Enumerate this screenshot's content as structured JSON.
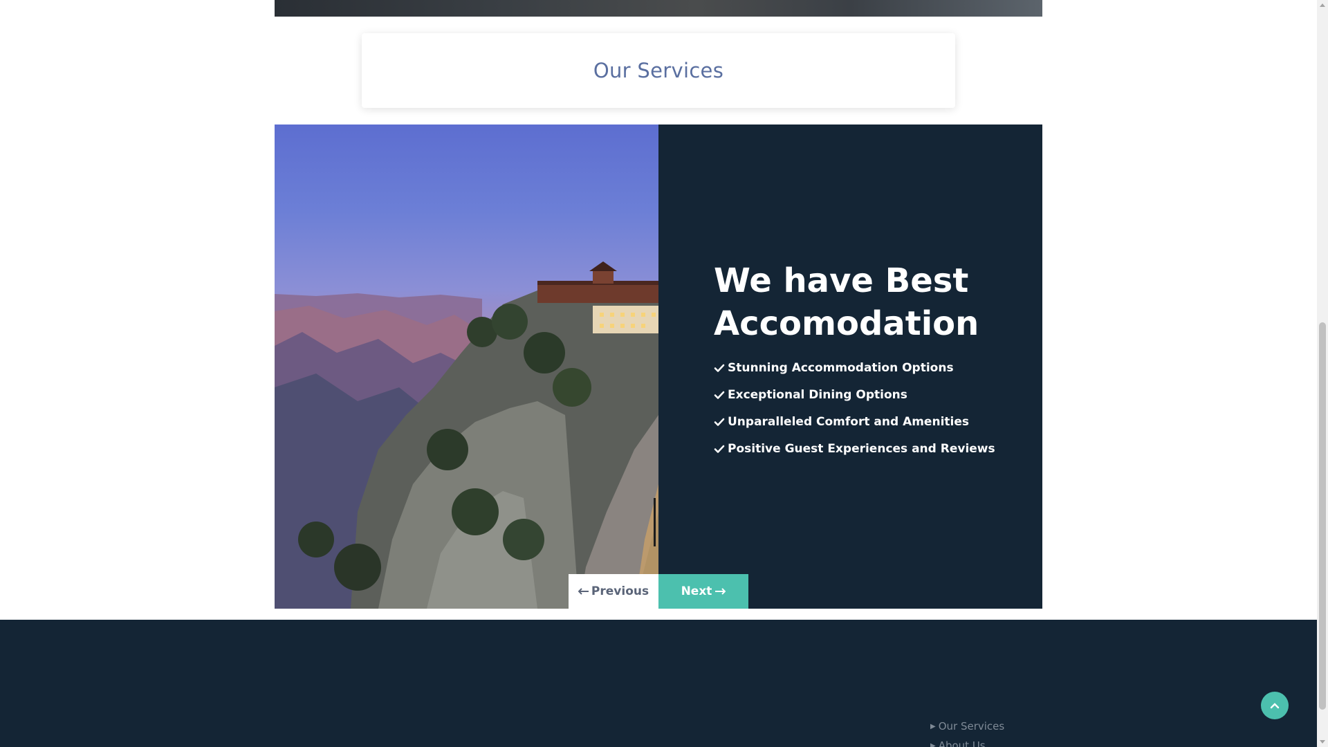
{
  "services": {
    "title": "Our Services"
  },
  "slide": {
    "heading": "We have Best Accomodation",
    "features": [
      "Stunning Accommodation Options",
      "Exceptional Dining Options",
      "Unparalleled Comfort and Amenities",
      "Positive Guest Experiences and Reviews"
    ]
  },
  "slider_nav": {
    "prev_label": "Previous",
    "next_label": "Next"
  },
  "footer": {
    "links": [
      "Our Services",
      "About Us"
    ]
  },
  "icons": {
    "check": "check-icon",
    "arrow_left": "arrow-left-icon",
    "arrow_right": "arrow-right-icon",
    "back_to_top": "chevron-up-icon"
  },
  "colors": {
    "accent": "#4cc0ae",
    "dark_navy": "#142535",
    "services_title": "#5a6fa0"
  }
}
